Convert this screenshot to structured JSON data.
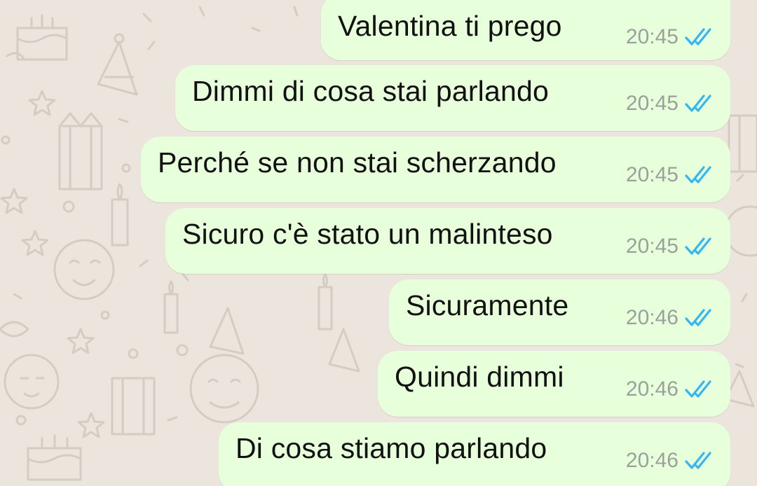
{
  "theme": {
    "background": "#ece5dd",
    "outgoing_bubble": "#e7ffdb",
    "text_color": "#111111",
    "time_color": "#9aa19a",
    "read_tick_color": "#34b7f1"
  },
  "messages": [
    {
      "text": "Valentina ti prego",
      "time": "20:45",
      "status": "read-double-tick-icon"
    },
    {
      "text": "Dimmi di cosa stai parlando",
      "time": "20:45",
      "status": "read-double-tick-icon"
    },
    {
      "text": "Perché se non stai scherzando",
      "time": "20:45",
      "status": "read-double-tick-icon"
    },
    {
      "text": "Sicuro c'è stato un malinteso",
      "time": "20:45",
      "status": "read-double-tick-icon"
    },
    {
      "text": "Sicuramente",
      "time": "20:46",
      "status": "read-double-tick-icon"
    },
    {
      "text": "Quindi dimmi",
      "time": "20:46",
      "status": "read-double-tick-icon"
    },
    {
      "text": "Di cosa stiamo parlando",
      "time": "20:46",
      "status": "read-double-tick-icon"
    }
  ]
}
